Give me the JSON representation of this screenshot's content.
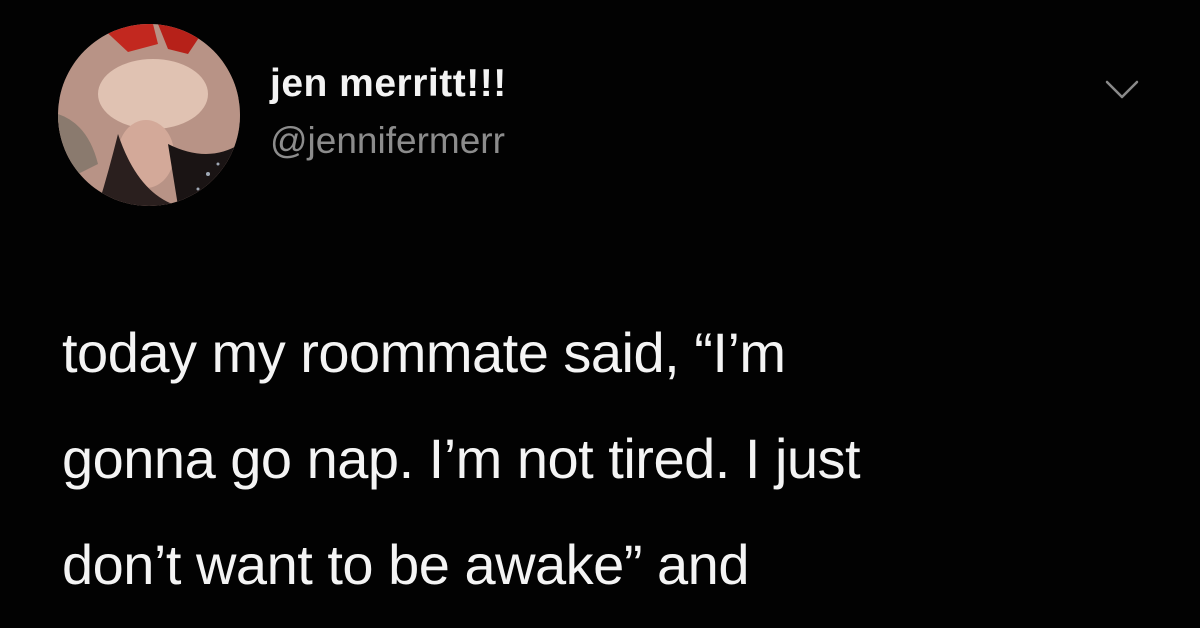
{
  "tweet": {
    "author": {
      "display_name": "jen merritt!!!",
      "handle": "@jennifermerr",
      "avatar_icon": "profile-photo"
    },
    "menu_icon": "chevron-down-icon",
    "text_lines": [
      "today my roommate said, “I’m",
      "gonna go nap. I’m not tired. I just",
      "don’t want to be awake” and"
    ]
  },
  "colors": {
    "background": "#020202",
    "name": "#f3f3f3",
    "handle": "#8c8c8c",
    "body_text": "#f4f4f4",
    "chevron": "#8a8a8a"
  }
}
